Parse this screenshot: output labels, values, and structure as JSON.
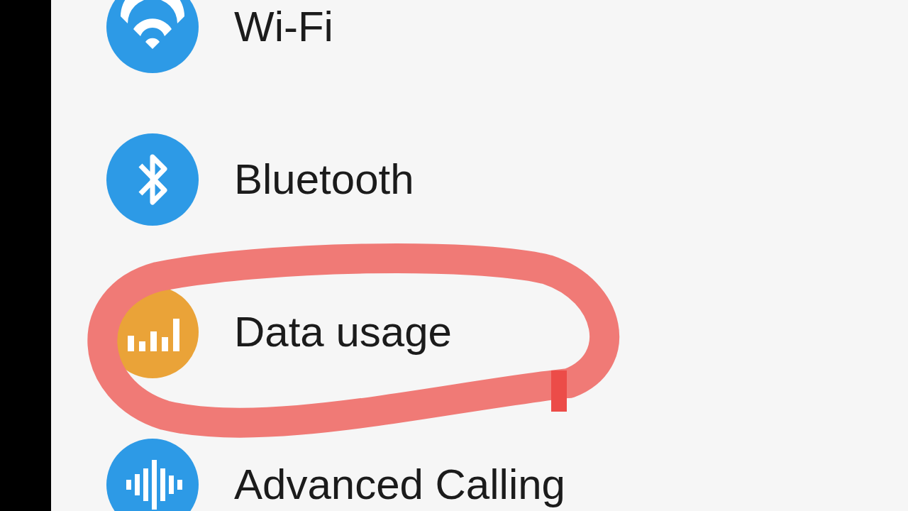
{
  "settings_items": [
    {
      "label": "Wi-Fi",
      "kind": "wifi",
      "color": "#2d9ae6",
      "highlighted": false
    },
    {
      "label": "Bluetooth",
      "kind": "bluetooth",
      "color": "#2d9ae6",
      "highlighted": false
    },
    {
      "label": "Data usage",
      "kind": "data",
      "color": "#eaa338",
      "highlighted": true
    },
    {
      "label": "Advanced Calling",
      "kind": "calling",
      "color": "#2d9ae6",
      "highlighted": false
    }
  ]
}
